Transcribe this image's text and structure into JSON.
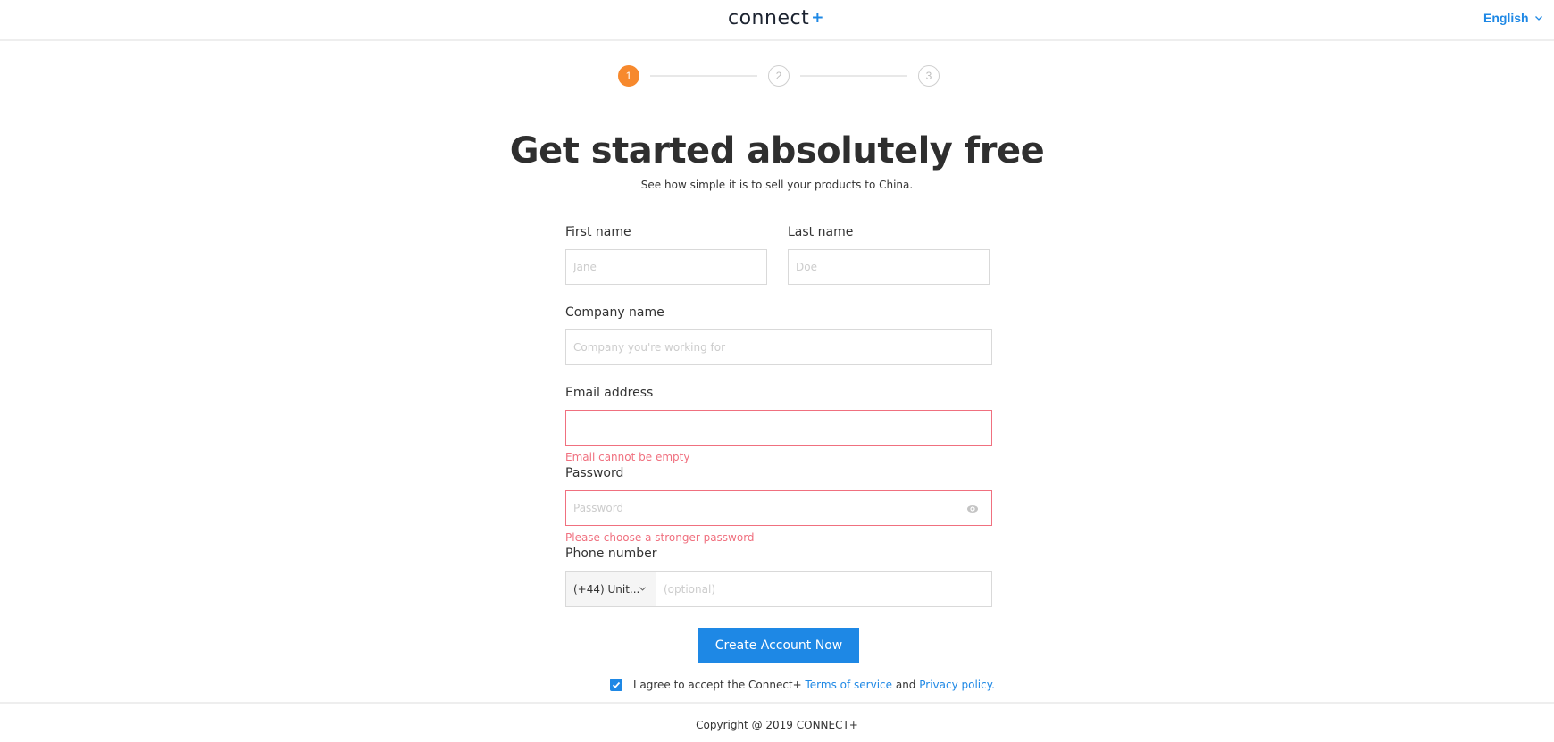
{
  "header": {
    "logo_text": "connect",
    "logo_plus": "+",
    "language": "English"
  },
  "stepper": {
    "steps": [
      {
        "label": "1",
        "state": "active"
      },
      {
        "label": "2",
        "state": "inactive"
      },
      {
        "label": "3",
        "state": "inactive"
      }
    ]
  },
  "hero": {
    "title": "Get started absolutely free",
    "subtitle": "See how simple it is to sell your products to China."
  },
  "form": {
    "first_name": {
      "label": "First name",
      "placeholder": "Jane",
      "value": ""
    },
    "last_name": {
      "label": "Last name",
      "placeholder": "Doe",
      "value": ""
    },
    "company": {
      "label": "Company name",
      "placeholder": "Company you're working for",
      "value": ""
    },
    "email": {
      "label": "Email address",
      "placeholder": "",
      "value": "",
      "error": "Email cannot be empty"
    },
    "password": {
      "label": "Password",
      "placeholder": "Password",
      "value": "",
      "error": "Please choose a stronger password"
    },
    "phone": {
      "label": "Phone number",
      "country_code": "(+44) Unit...",
      "placeholder": "(optional)",
      "value": ""
    },
    "submit_label": "Create Account Now",
    "agree": {
      "checked": true,
      "prefix": "I agree to accept the Connect+ ",
      "terms_link": "Terms of service",
      "middle": " and ",
      "privacy_link": "Privacy policy."
    }
  },
  "footer": {
    "copyright": "Copyright @ 2019 CONNECT+"
  },
  "colors": {
    "accent": "#1e88e5",
    "step_active": "#f7892d",
    "error": "#f0707f"
  }
}
